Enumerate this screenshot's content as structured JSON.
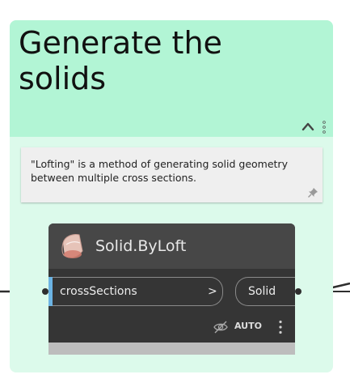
{
  "group": {
    "title": "Generate the solids",
    "header_color": "#b2f5d5",
    "body_color": "#dcfaeb",
    "collapse_icon": "chevron-up-icon",
    "menu_icon": "dots-vertical-icon"
  },
  "note": {
    "text": "\"Lofting\" is a method of generating solid geometry between multiple cross sections.",
    "pin_icon": "pin-icon"
  },
  "node": {
    "title": "Solid.ByLoft",
    "icon": "solid-loft-icon",
    "input_label": "crossSections",
    "input_chevron": ">",
    "output_label": "Solid",
    "run_mode": "AUTO",
    "preview_icon": "eye-off-icon",
    "menu_icon": "dots-vertical-icon",
    "input_marker_color": "#6cb4e4"
  }
}
